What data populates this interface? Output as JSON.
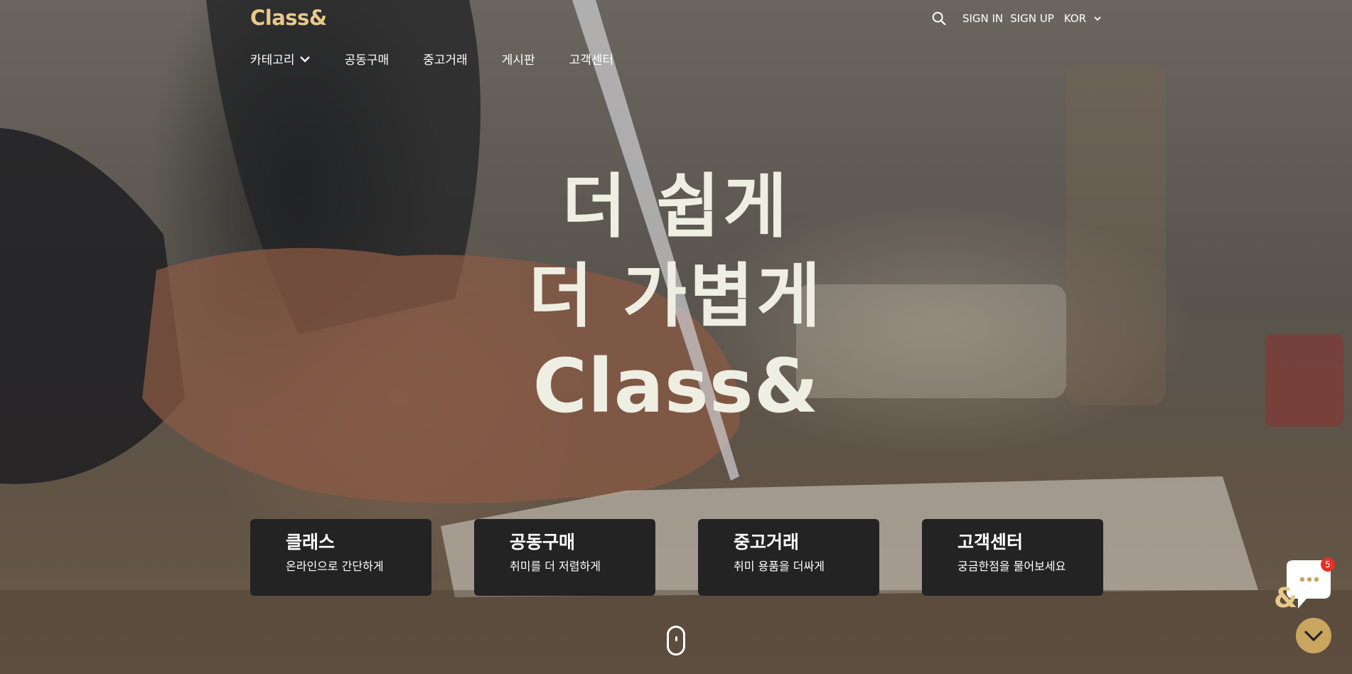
{
  "header": {
    "logo": "Class&",
    "sign_in": "SIGN IN",
    "sign_up": "SIGN UP",
    "language": "KOR",
    "icons": {
      "search": "search-icon",
      "lang_toggle": "chevron-down-icon"
    }
  },
  "nav": {
    "items": [
      {
        "label": "카테고리",
        "has_dropdown": true
      },
      {
        "label": "공동구매"
      },
      {
        "label": "중고거래"
      },
      {
        "label": "게시판"
      },
      {
        "label": "고객센터"
      }
    ]
  },
  "hero": {
    "line1": "더 쉽게",
    "line2": "더 가볍게",
    "line3": "Class&"
  },
  "cards": [
    {
      "title": "클래스",
      "subtitle": "온라인으로 간단하게"
    },
    {
      "title": "공동구매",
      "subtitle": "취미를 더 저렴하게"
    },
    {
      "title": "중고거래",
      "subtitle": "취미 용품을 더싸게"
    },
    {
      "title": "고객센터",
      "subtitle": "궁금한점을 물어보세요"
    }
  ],
  "chat": {
    "badge_count": "5",
    "icon": "chat-bubble-icon"
  },
  "scroll_button": {
    "icon": "chevron-down-icon"
  },
  "colors": {
    "accent": "#e8c98a",
    "card_bg": "#232323",
    "button_gold": "#c9a55f",
    "badge_red": "#e53229",
    "hero_text": "#efeee2"
  }
}
